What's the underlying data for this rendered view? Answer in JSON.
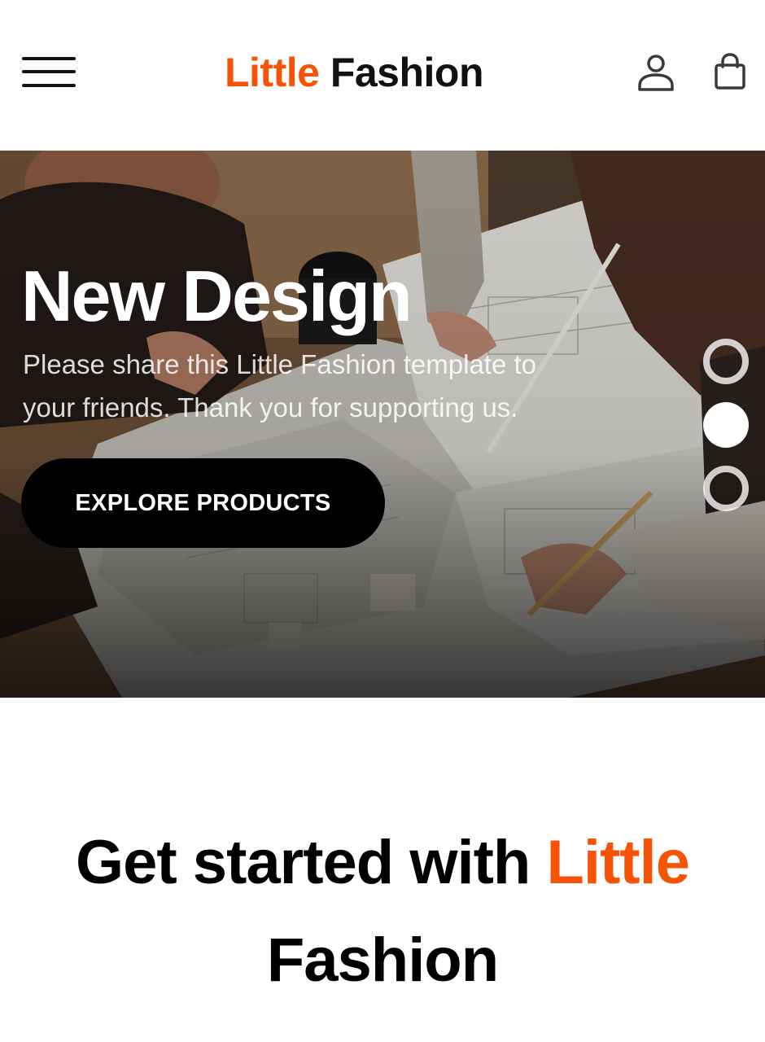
{
  "header": {
    "menu_icon": "hamburger-menu-icon",
    "brand_accent": "Little",
    "brand_rest": "Fashion",
    "user_icon": "user-icon",
    "bag_icon": "shopping-bag-icon"
  },
  "hero": {
    "title": "New Design",
    "text": "Please share this Little Fashion template to your friends. Thank you for supporting us.",
    "cta_label": "EXPLORE PRODUCTS",
    "slides": [
      {
        "active": false
      },
      {
        "active": true
      },
      {
        "active": false
      }
    ]
  },
  "get_started": {
    "title_prefix": "Get started with",
    "title_accent": "Little",
    "title_suffix": "Fashion"
  },
  "colors": {
    "accent": "#f65307",
    "text": "#000000",
    "background": "#ffffff",
    "button": "#000000"
  }
}
